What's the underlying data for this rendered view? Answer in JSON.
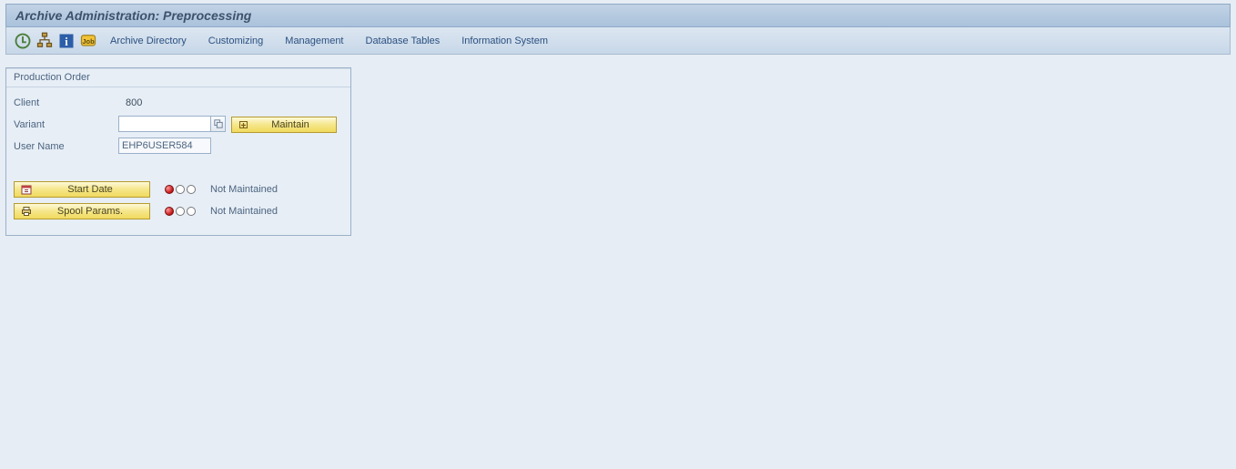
{
  "title": "Archive Administration: Preprocessing",
  "toolbar": {
    "links": [
      "Archive Directory",
      "Customizing",
      "Management",
      "Database Tables",
      "Information System"
    ]
  },
  "group": {
    "title": "Production Order",
    "client_label": "Client",
    "client_value": "800",
    "variant_label": "Variant",
    "variant_value": "",
    "maintain_label": "Maintain",
    "username_label": "User Name",
    "username_value": "EHP6USER584"
  },
  "status": {
    "start_date_label": "Start Date",
    "spool_label": "Spool Params.",
    "not_maintained": "Not Maintained"
  }
}
